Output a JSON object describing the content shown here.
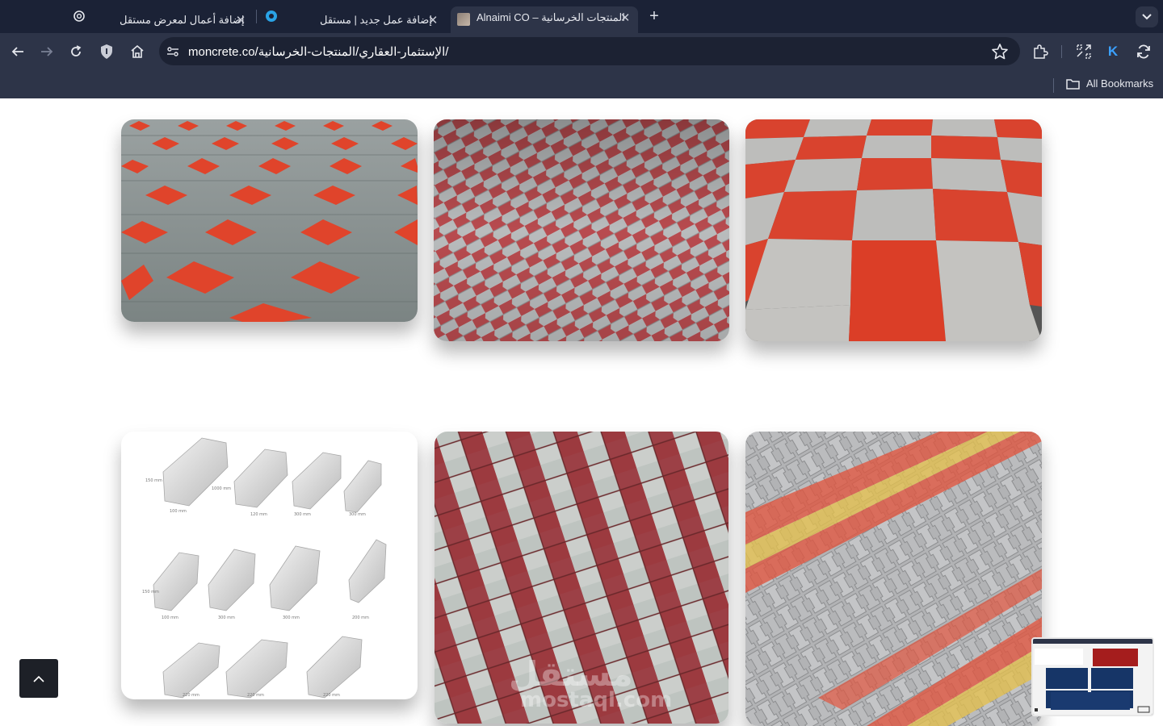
{
  "tabs": [
    {
      "title": "إضافة أعمال لمعرض مستقل",
      "favicon": "openai-icon"
    },
    {
      "title": "إضافة عمل جديد | مستقل",
      "favicon": "mostaql-icon"
    },
    {
      "title": "Alnaimi CO – المنتجات الخرسانية",
      "favicon": "site-thumb-icon",
      "active": true
    }
  ],
  "address_bar": {
    "url": "moncrete.co/الإستثمار-العقاري/المنتجات-الخرسانية/"
  },
  "bookmarks_bar": {
    "all_bookmarks": "All Bookmarks"
  },
  "profile": {
    "initial": "K"
  },
  "gallery": {
    "images": [
      {
        "alt": "hexagon-red-grey-pavers"
      },
      {
        "alt": "zigzag-red-grey-pavers"
      },
      {
        "alt": "square-red-grey-checker-tiles"
      },
      {
        "alt": "concrete-curbstones-diagram"
      },
      {
        "alt": "square-red-white-pavers"
      },
      {
        "alt": "i-shape-red-yellow-grey-pavers"
      }
    ],
    "watermark_ar": "مستقل",
    "watermark_en": "mostaql.com"
  },
  "colors": {
    "chrome_dark": "#1b2236",
    "chrome": "#2d3448",
    "paver_red": "#d9432e",
    "paver_grey": "#8c9394"
  }
}
